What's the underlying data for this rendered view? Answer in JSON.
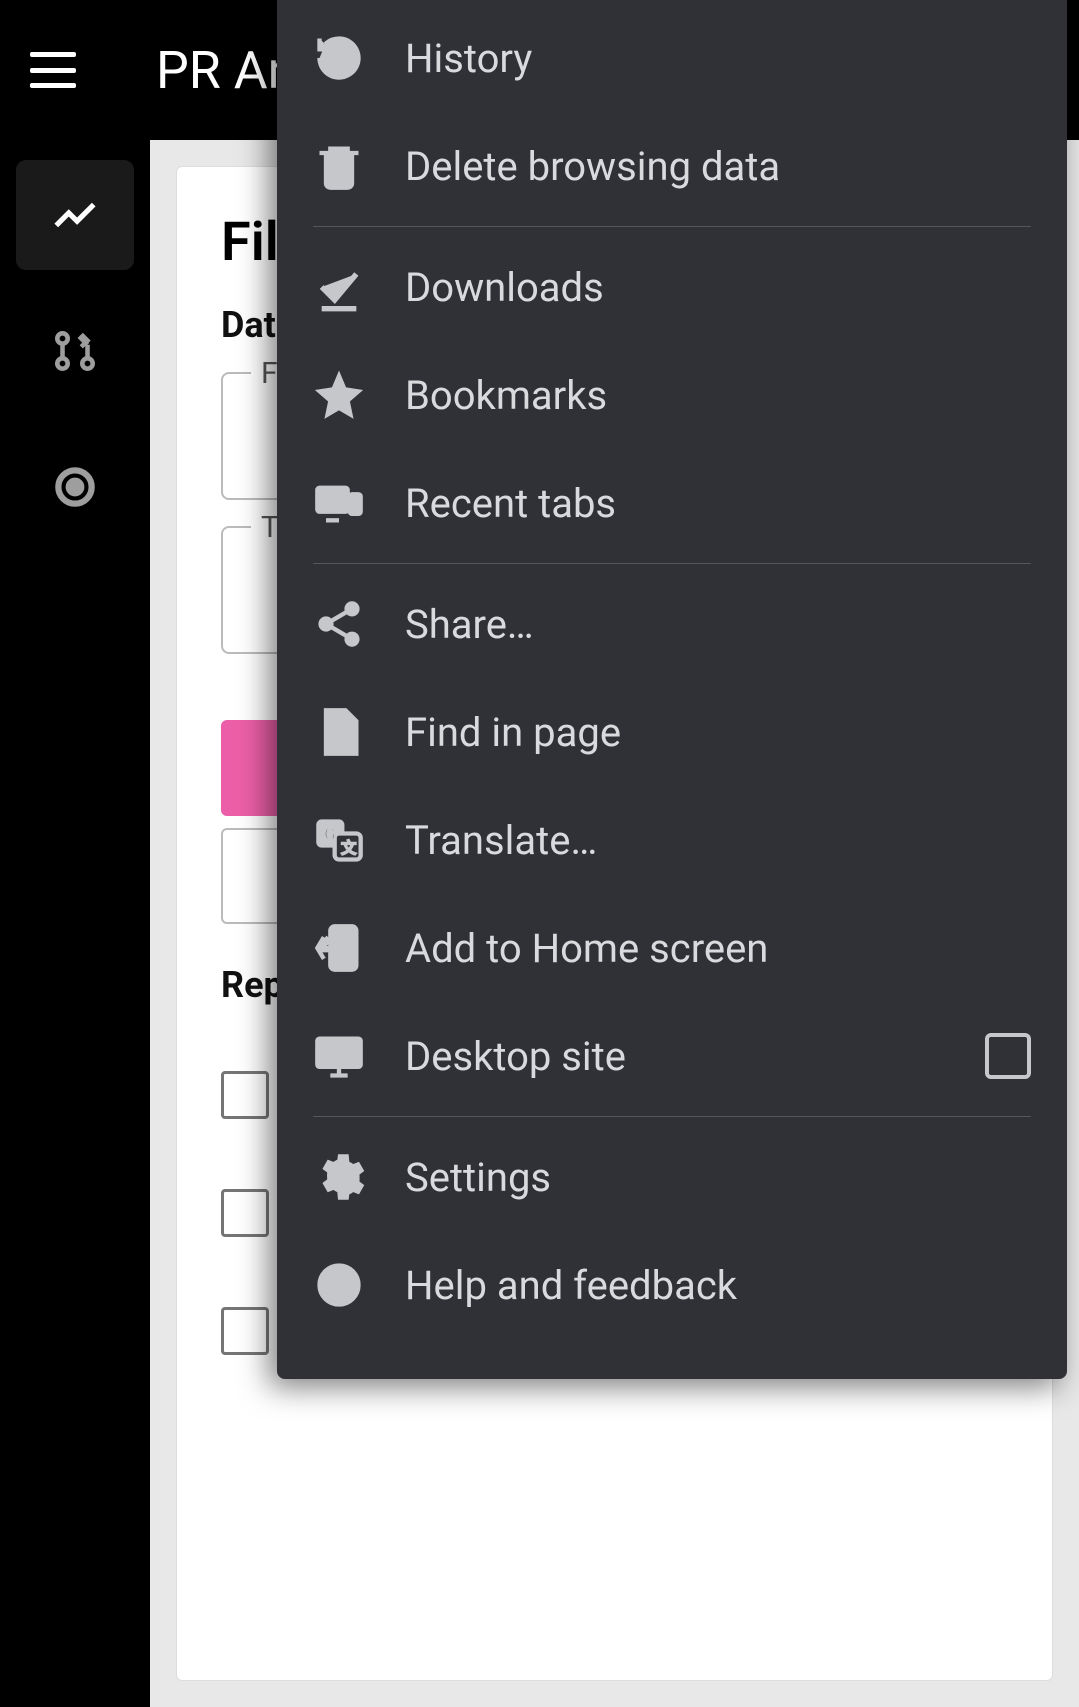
{
  "topbar": {
    "title": "PR An"
  },
  "nav": {
    "items": [
      {
        "name": "analytics-icon"
      },
      {
        "name": "pull-request-icon"
      },
      {
        "name": "target-icon"
      }
    ]
  },
  "filter_card": {
    "title": "Fil",
    "date_label": "Dat",
    "from_legend": "F",
    "to_legend": "T",
    "repos_label": "Rep"
  },
  "menu": {
    "items": [
      {
        "icon": "history-icon",
        "label": "History"
      },
      {
        "icon": "trash-icon",
        "label": "Delete browsing data"
      },
      {
        "divider": true
      },
      {
        "icon": "download-done-icon",
        "label": "Downloads"
      },
      {
        "icon": "star-icon",
        "label": "Bookmarks"
      },
      {
        "icon": "recent-tabs-icon",
        "label": "Recent tabs"
      },
      {
        "divider": true
      },
      {
        "icon": "share-icon",
        "label": "Share…"
      },
      {
        "icon": "find-in-page-icon",
        "label": "Find in page"
      },
      {
        "icon": "translate-icon",
        "label": "Translate…"
      },
      {
        "icon": "add-to-home-icon",
        "label": "Add to Home screen"
      },
      {
        "icon": "desktop-icon",
        "label": "Desktop site",
        "checkbox": true,
        "checked": false
      },
      {
        "divider": true
      },
      {
        "icon": "gear-icon",
        "label": "Settings"
      },
      {
        "icon": "help-icon",
        "label": "Help and feedback"
      }
    ]
  }
}
